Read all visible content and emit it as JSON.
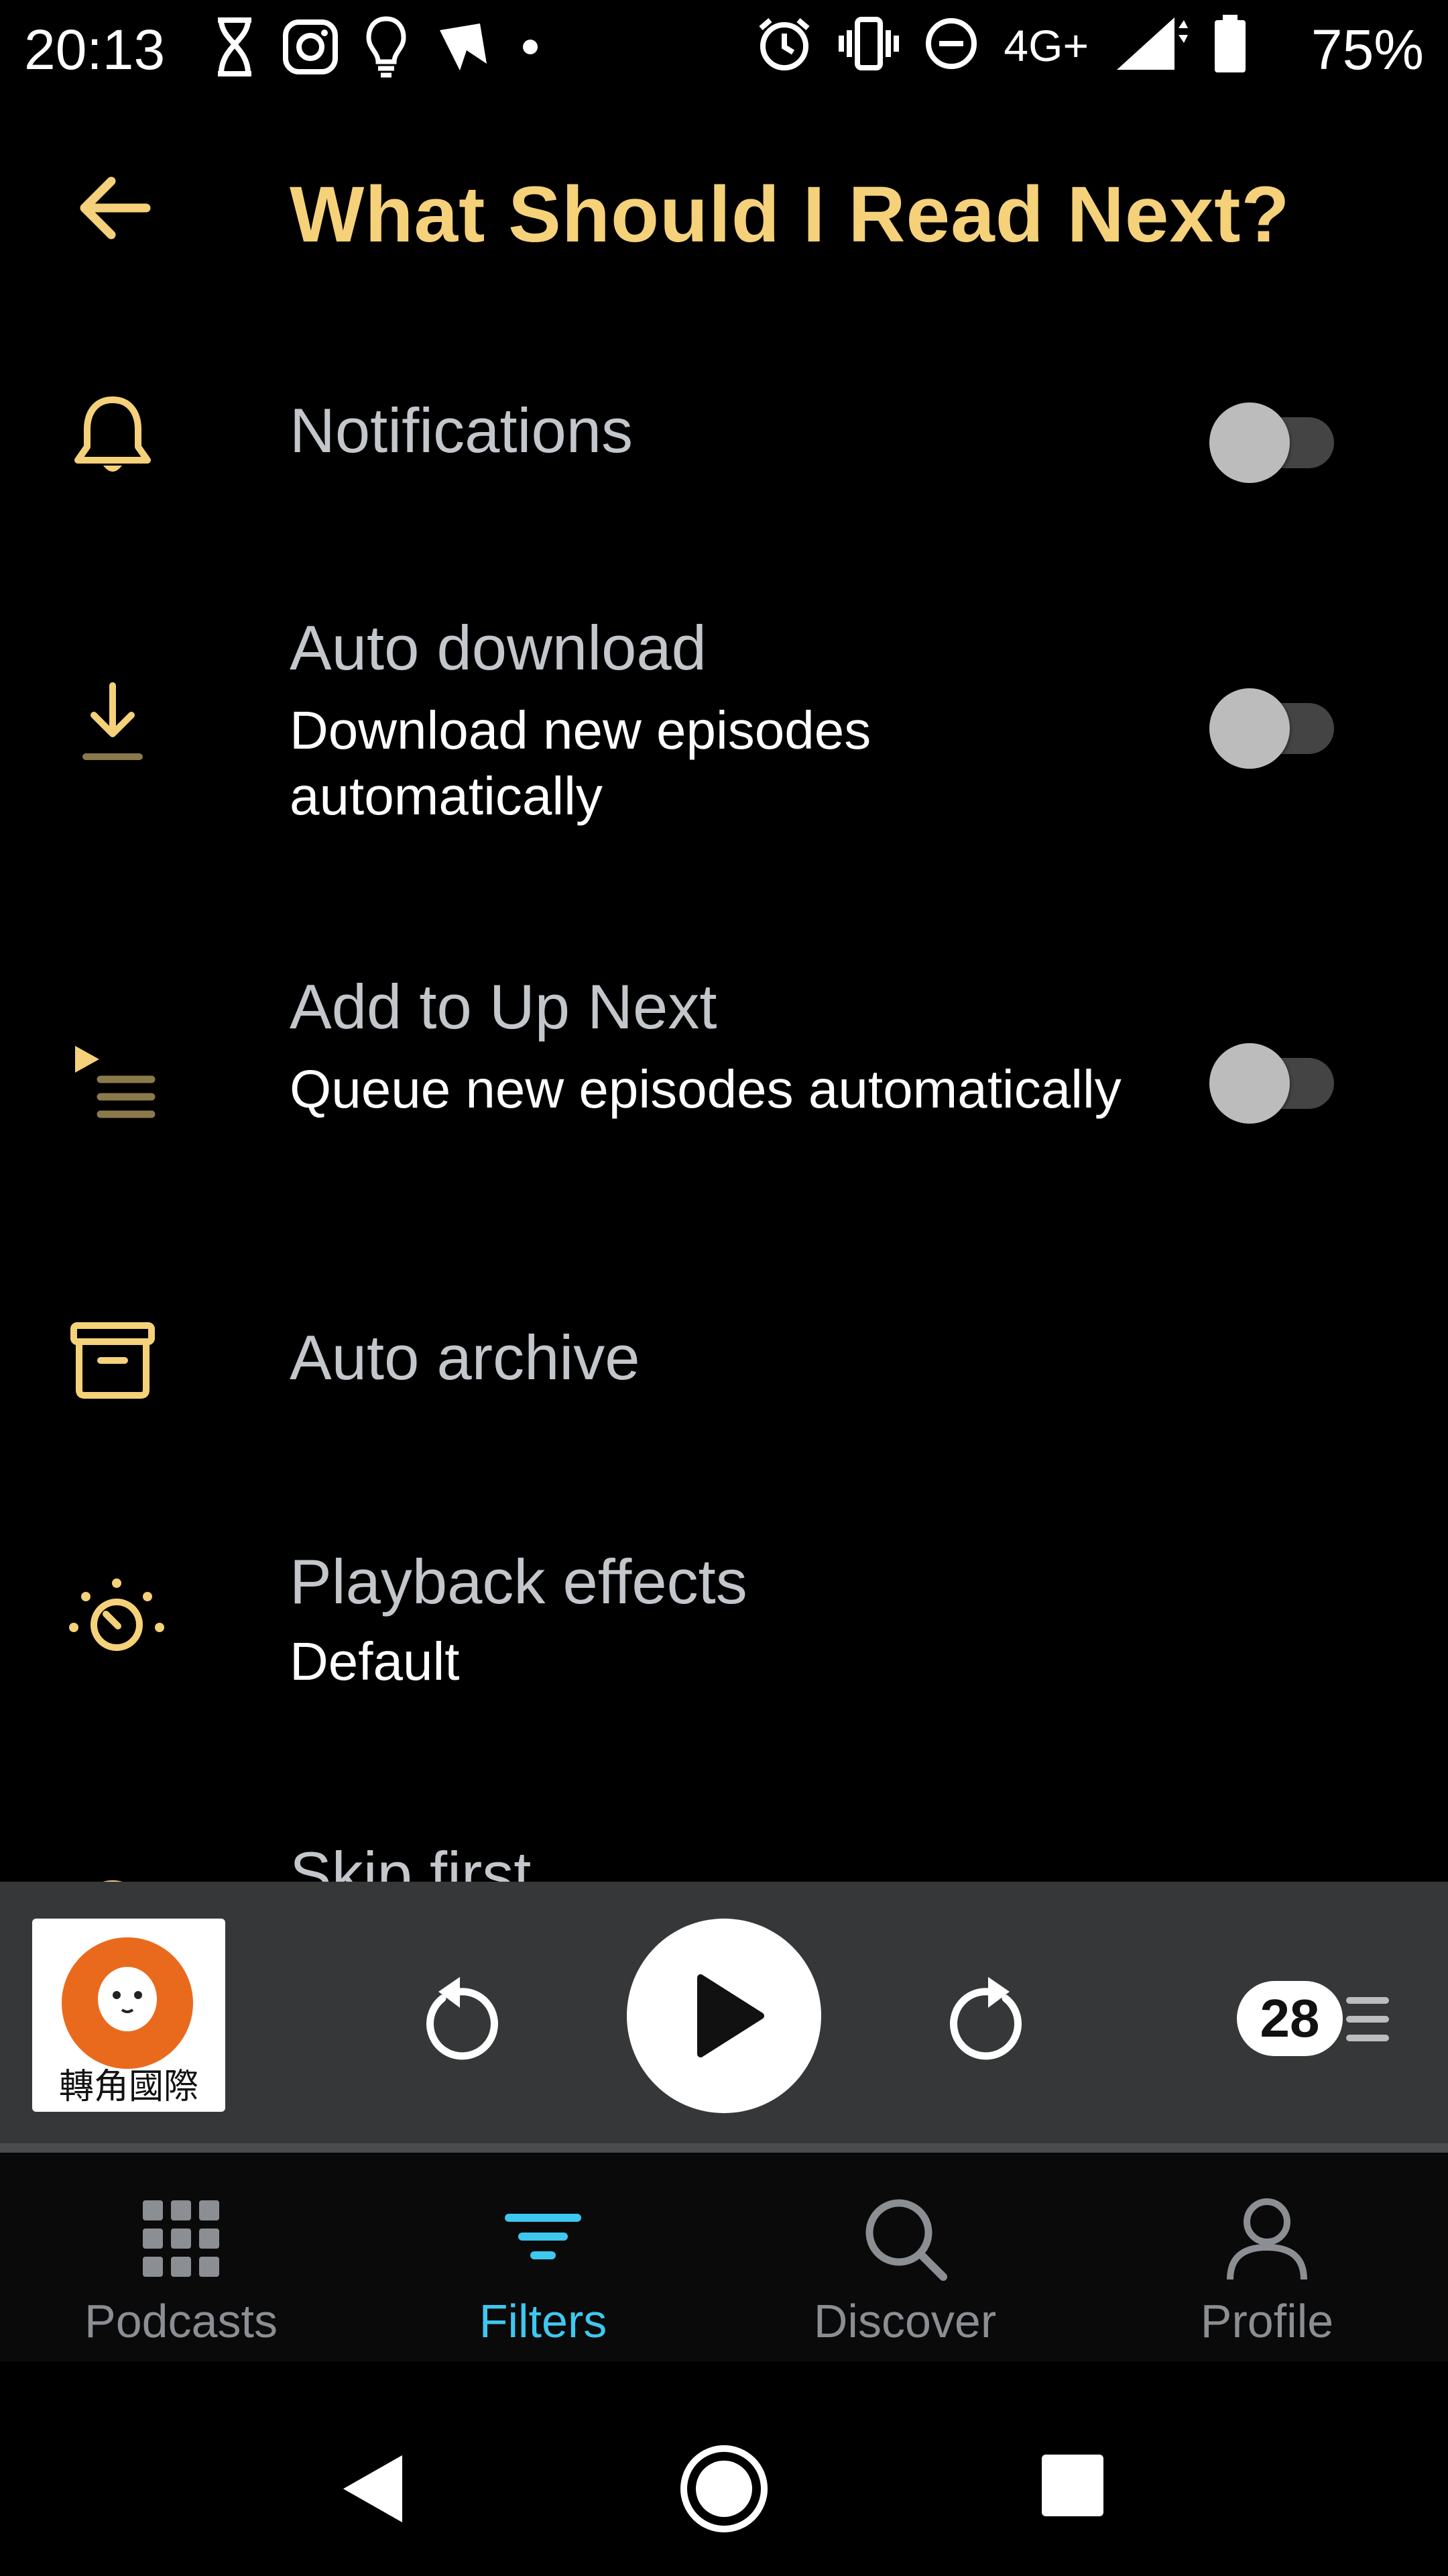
{
  "status_bar": {
    "time": "20:13",
    "network": "4G+",
    "battery": "75%"
  },
  "app_bar": {
    "title": "What Should I Read Next?"
  },
  "settings": [
    {
      "title": "Notifications",
      "subtitle": "",
      "icon": "bell-icon",
      "toggle": false
    },
    {
      "title": "Auto download",
      "subtitle": "Download new episodes automatically",
      "icon": "download-icon",
      "toggle": false
    },
    {
      "title": "Add to Up Next",
      "subtitle": "Queue new episodes automatically",
      "icon": "queue-icon",
      "toggle": false
    },
    {
      "title": "Auto archive",
      "subtitle": "",
      "icon": "archive-icon"
    },
    {
      "title": "Playback effects",
      "subtitle": "Default",
      "icon": "playback-effects-icon"
    },
    {
      "title": "Skip first",
      "subtitle": "",
      "icon": "skip-icon"
    }
  ],
  "mini_player": {
    "artwork_text": "轉角國際",
    "up_next_count": "28"
  },
  "bottom_nav": [
    {
      "label": "Podcasts",
      "icon": "grid-icon",
      "active": false
    },
    {
      "label": "Filters",
      "icon": "filter-icon",
      "active": true
    },
    {
      "label": "Discover",
      "icon": "search-icon",
      "active": false
    },
    {
      "label": "Profile",
      "icon": "profile-icon",
      "active": false
    }
  ],
  "colors": {
    "accent": "#f5d17a",
    "active_nav": "#3fc8ef",
    "background": "#000000",
    "player_bg": "#363738"
  }
}
